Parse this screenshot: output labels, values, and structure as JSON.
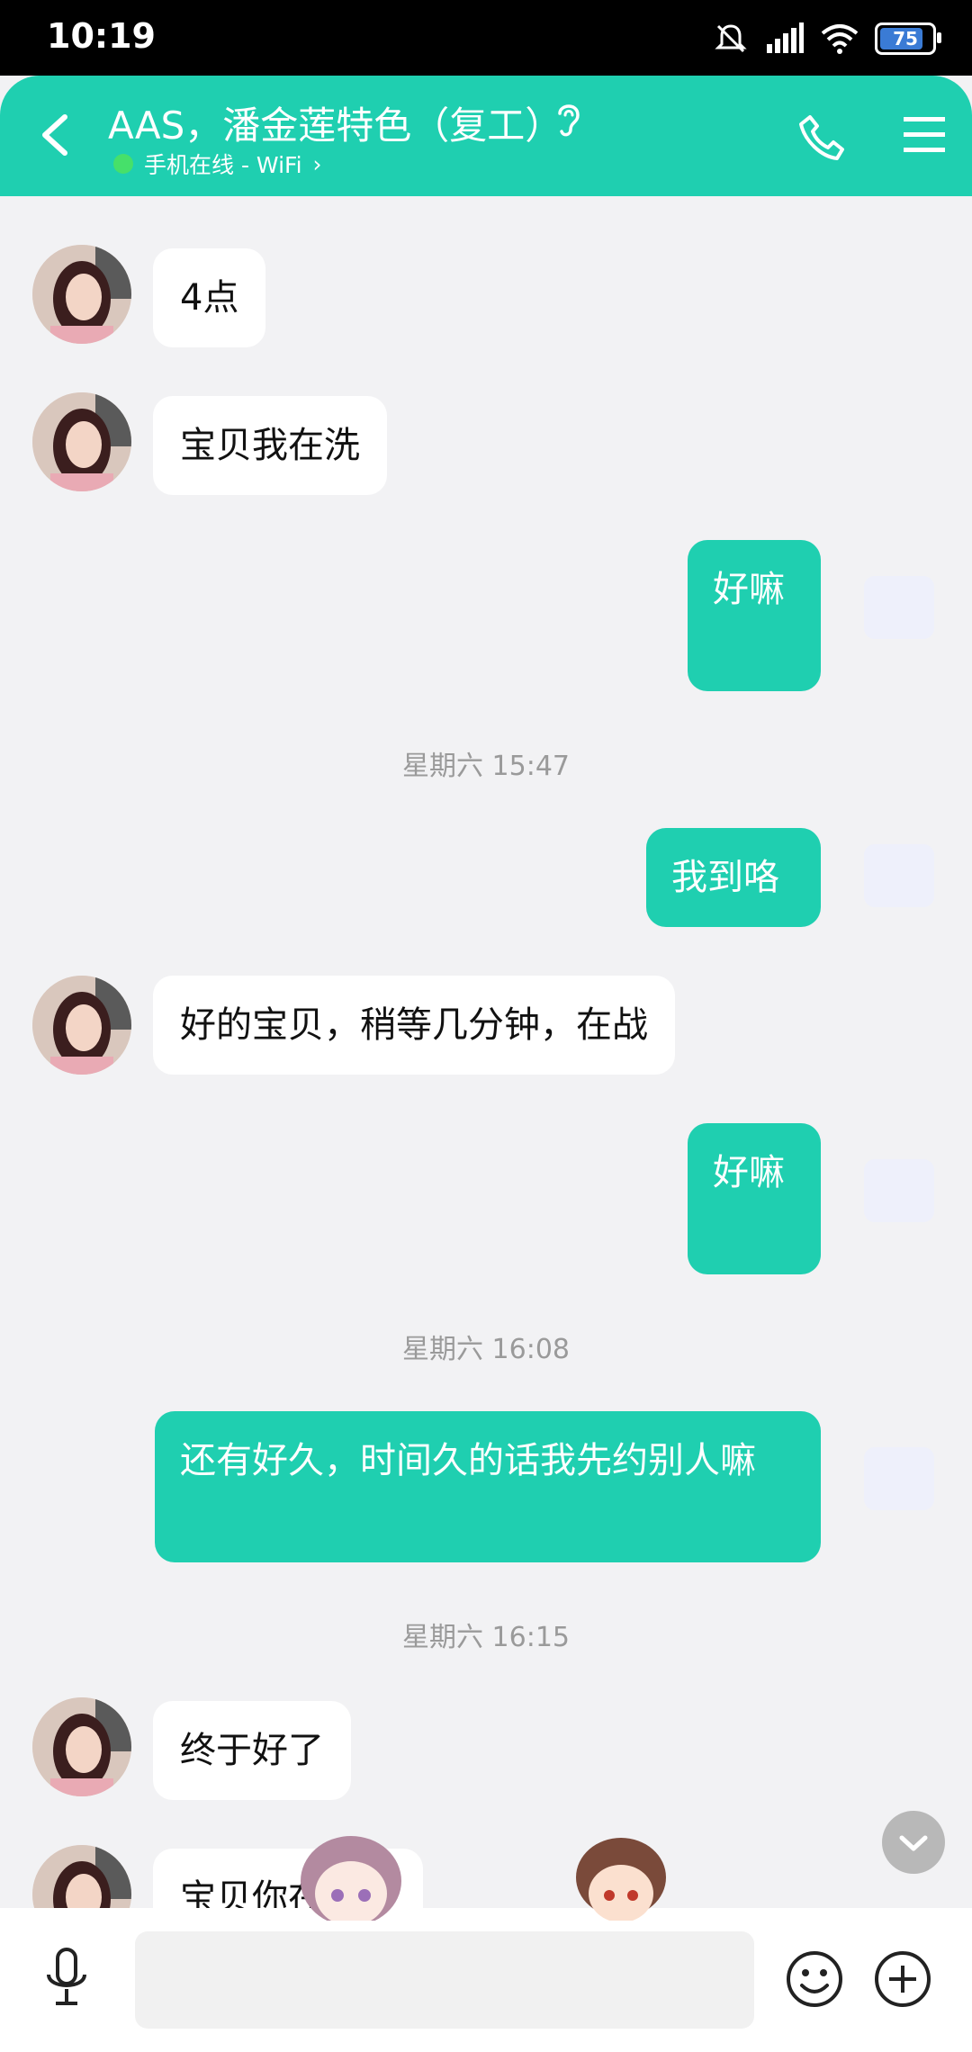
{
  "status_bar": {
    "time": "10:19",
    "battery": "75",
    "icons": [
      "mute-bell-icon",
      "signal-icon",
      "wifi-icon",
      "battery-icon"
    ]
  },
  "header": {
    "title": "AAS，潘金莲特色（复工）",
    "status": "手机在线 - WiFi",
    "accent_color": "#1fcfb0",
    "icons": [
      "back-arrow-icon",
      "ear-icon",
      "phone-icon",
      "menu-icon"
    ]
  },
  "messages": [
    {
      "side": "in",
      "text": "4点"
    },
    {
      "side": "in",
      "text": "宝贝我在洗"
    },
    {
      "side": "out",
      "text": "好嘛"
    },
    {
      "type": "time",
      "text": "星期六 15:47"
    },
    {
      "side": "out",
      "text": "我到咯"
    },
    {
      "side": "in",
      "text": "好的宝贝，稍等几分钟，在战"
    },
    {
      "side": "out",
      "text": "好嘛"
    },
    {
      "type": "time",
      "text": "星期六 16:08"
    },
    {
      "side": "out",
      "text": "还有好久，时间久的话我先约别人嘛"
    },
    {
      "type": "time",
      "text": "星期六 16:15"
    },
    {
      "side": "in",
      "text": "终于好了"
    },
    {
      "side": "in",
      "text": "宝贝你在哪里"
    }
  ],
  "input_bar": {
    "placeholder": "",
    "icons": [
      "microphone-icon",
      "emoji-icon",
      "plus-icon"
    ]
  }
}
